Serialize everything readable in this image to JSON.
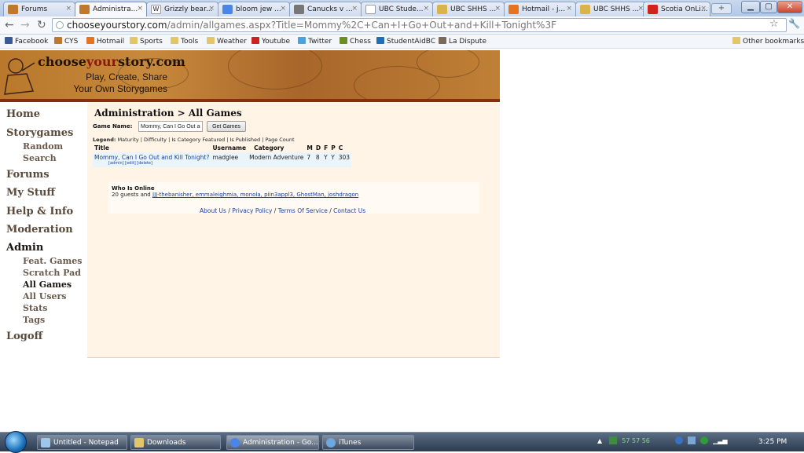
{
  "browser": {
    "tabs": [
      {
        "label": "Forums",
        "color": "#c0782c"
      },
      {
        "label": "Administra...",
        "color": "#c0782c"
      },
      {
        "label": "Grizzly bear...",
        "color": "#ffffff"
      },
      {
        "label": "bloom jew ...",
        "color": "#4a86e8"
      },
      {
        "label": "Canucks v ...",
        "color": "#777777"
      },
      {
        "label": "UBC Stude...",
        "color": "#ffffff"
      },
      {
        "label": "UBC SHHS ...",
        "color": "#d9b44a"
      },
      {
        "label": "Hotmail - j...",
        "color": "#e8731e"
      },
      {
        "label": "UBC SHHS ...",
        "color": "#d9b44a"
      },
      {
        "label": "Scotia OnLi...",
        "color": "#d0231e"
      }
    ],
    "new_tab_symbol": "+",
    "url_host": "chooseyourstory.com",
    "url_path": "/admin/allgames.aspx?Title=Mommy%2C+Can+I+Go+Out+and+Kill+Tonight%3F",
    "bookmarks": [
      {
        "label": "Facebook",
        "color": "#3b5998"
      },
      {
        "label": "CYS",
        "color": "#c0782c"
      },
      {
        "label": "Hotmail",
        "color": "#e8731e"
      },
      {
        "label": "Sports",
        "color": "#e3c56a"
      },
      {
        "label": "Tools",
        "color": "#e3c56a"
      },
      {
        "label": "Weather",
        "color": "#e3c56a"
      },
      {
        "label": "Youtube",
        "color": "#cc2222"
      },
      {
        "label": "Twitter",
        "color": "#4aa3df"
      },
      {
        "label": "Chess",
        "color": "#6b8e23"
      },
      {
        "label": "StudentAidBC",
        "color": "#1f6fb5"
      },
      {
        "label": "La Dispute",
        "color": "#7a6a5a"
      }
    ],
    "other_bookmarks": "Other bookmarks"
  },
  "site": {
    "logo_choose": "choose",
    "logo_your": "your",
    "logo_story": "story.com",
    "tagline1": "Play, Create, Share",
    "tagline2": "Your Own Storygames"
  },
  "sidebar": {
    "home": "Home",
    "storygames": "Storygames",
    "random": "Random",
    "search": "Search",
    "forums": "Forums",
    "my_stuff": "My Stuff",
    "help_info": "Help & Info",
    "moderation": "Moderation",
    "admin": "Admin",
    "feat_games": "Feat. Games",
    "scratch_pad": "Scratch Pad",
    "all_games": "All Games",
    "all_users": "All Users",
    "stats": "Stats",
    "tags": "Tags",
    "logoff": "Logoff"
  },
  "main": {
    "title": "Administration > All Games",
    "game_name_label": "Game Name:",
    "game_name_value": "Mommy, Can I Go Out and Kill Tonight?",
    "get_games_label": "Get Games",
    "legend_prefix": "Legend:",
    "legend_items": "Maturity | Difficulty | Is Category Featured | Is Published | Page Count",
    "table": {
      "headers": [
        "Title",
        "Username",
        "Category",
        "M",
        "D",
        "F",
        "P",
        "C"
      ],
      "rows": [
        {
          "title": "Mommy, Can I Go Out and Kill Tonight?",
          "actions": "[admin] [edit] [delete]",
          "username": "madglee",
          "category": "Modern Adventure",
          "m": "7",
          "d": "8",
          "f": "Y",
          "p": "Y",
          "c": "303"
        }
      ]
    },
    "who_is_online_title": "Who Is Online",
    "who_is_online_count": "20 guests and",
    "who_is_online_users": "JJJ-thebanisher, emmaleighmia, monola, piin3appl3, GhostMan, joshdragon",
    "footer": {
      "about": "About Us",
      "privacy": "Privacy Policy",
      "terms": "Terms Of Service",
      "contact": "Contact Us",
      "sep": "/"
    }
  },
  "taskbar": {
    "items": [
      {
        "label": "Untitled - Notepad",
        "color": "#9fc5e8"
      },
      {
        "label": "Downloads",
        "color": "#e3c56a"
      },
      {
        "label": "Administration - Go...",
        "color": "#4a86e8"
      },
      {
        "label": "iTunes",
        "color": "#6fa8dc"
      }
    ],
    "tray_numbers": "57  57  56",
    "clock": "3:25 PM"
  }
}
